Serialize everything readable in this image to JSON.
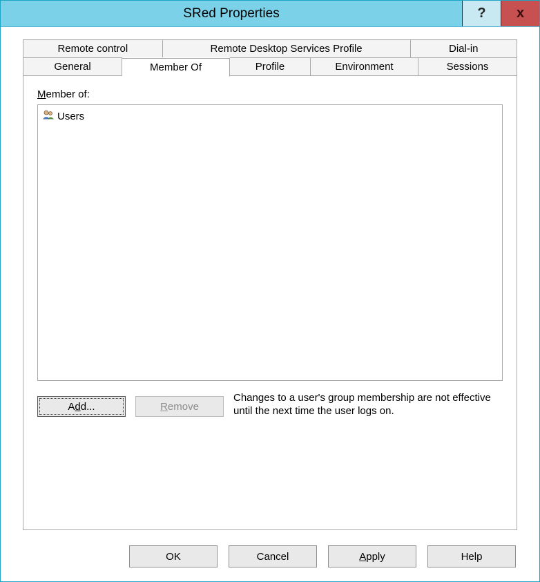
{
  "window": {
    "title": "SRed Properties",
    "help_glyph": "?",
    "close_glyph": "x"
  },
  "tabs": {
    "row1": {
      "remote_control": "Remote control",
      "rds_profile": "Remote Desktop Services Profile",
      "dialin": "Dial-in"
    },
    "row2": {
      "general": "General",
      "member_of": "Member Of",
      "profile": "Profile",
      "environment": "Environment",
      "sessions": "Sessions"
    },
    "active": "Member Of"
  },
  "member_of": {
    "label_pre": "M",
    "label_post": "ember of:",
    "items": [
      {
        "name": "Users"
      }
    ],
    "add_pre": "A",
    "add_ul": "d",
    "add_post": "d...",
    "remove_ul": "R",
    "remove_post": "emove",
    "note": "Changes to a user's group membership are not effective until the next time the user logs on."
  },
  "buttons": {
    "ok": "OK",
    "cancel": "Cancel",
    "apply_ul": "A",
    "apply_post": "pply",
    "help": "Help"
  }
}
